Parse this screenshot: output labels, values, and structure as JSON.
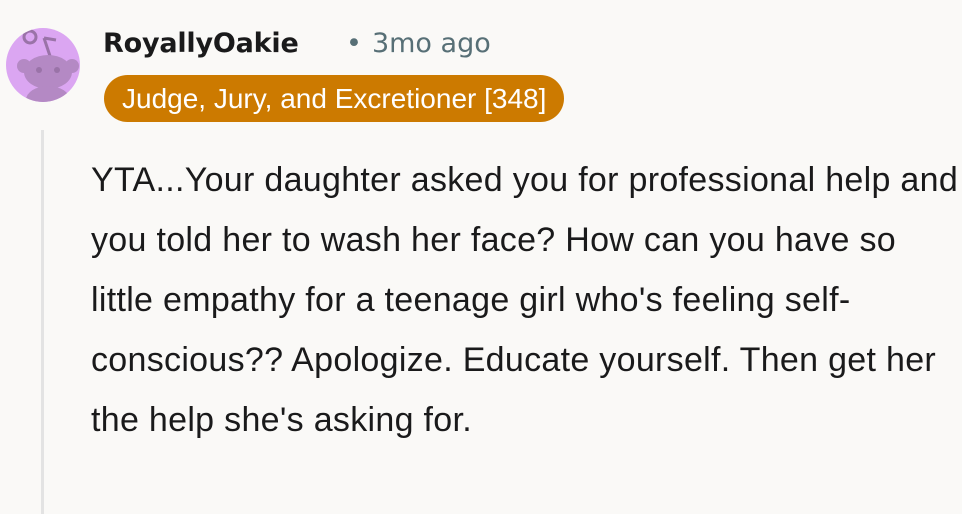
{
  "comment": {
    "author": "RoyallyOakie",
    "separator": "•",
    "timestamp": "3mo ago",
    "flair": "Judge, Jury, and Excretioner [348]",
    "body": "YTA...Your daughter asked you for professional help and you told her to wash her face? How can you have so little empathy for a teenage girl who's feeling self-conscious?? Apologize. Educate yourself. Then get her the help she's asking for."
  },
  "avatar": {
    "icon": "snoo-avatar-icon",
    "background_color": "#dba6f2"
  },
  "colors": {
    "flair_background": "#cc7a00",
    "flair_text": "#ffffff",
    "meta_text": "#576f76",
    "page_background": "#faf9f7"
  }
}
